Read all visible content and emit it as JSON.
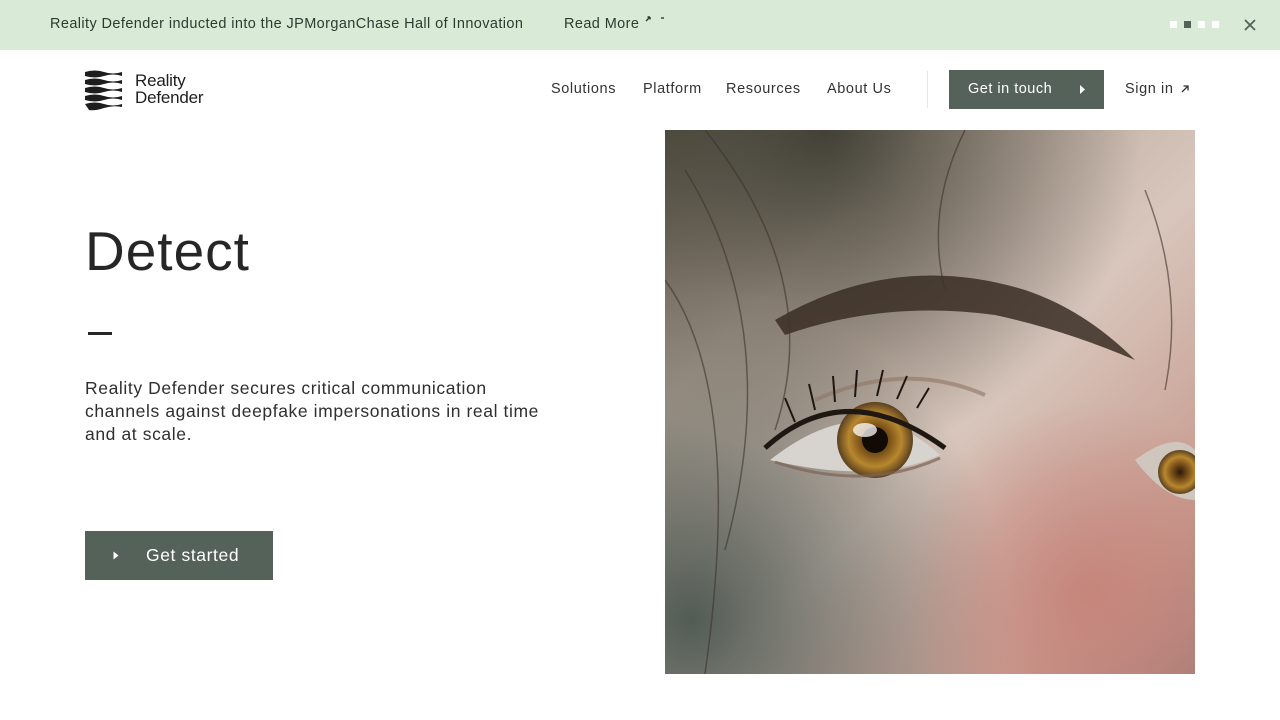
{
  "announcement": {
    "text": "Reality Defender inducted into the JPMorganChase Hall of Innovation",
    "link_label": "Read More",
    "link_icon": "arrow-sparkle-icon",
    "slides_total": 4,
    "slide_active_index": 1,
    "close_icon": "close-icon",
    "background_color": "#d9ebd6"
  },
  "header": {
    "logo": {
      "line1": "Reality",
      "line2": "Defender",
      "icon": "reality-defender-logo-mark"
    },
    "nav": [
      "Solutions",
      "Platform",
      "Resources",
      "About Us"
    ],
    "cta_label": "Get in touch",
    "cta_icon": "caret-right-icon",
    "signin_label": "Sign in",
    "signin_icon": "arrow-up-right-icon"
  },
  "hero": {
    "title": "Detect",
    "description": "Reality Defender secures critical communication channels against deepfake impersonations in real time and at scale.",
    "button_label": "Get started",
    "button_icon": "caret-right-icon",
    "image_description_icon": "photo-close-up-eye"
  },
  "colors": {
    "accent": "#55625a",
    "text": "#262626",
    "banner": "#d9ebd6"
  }
}
